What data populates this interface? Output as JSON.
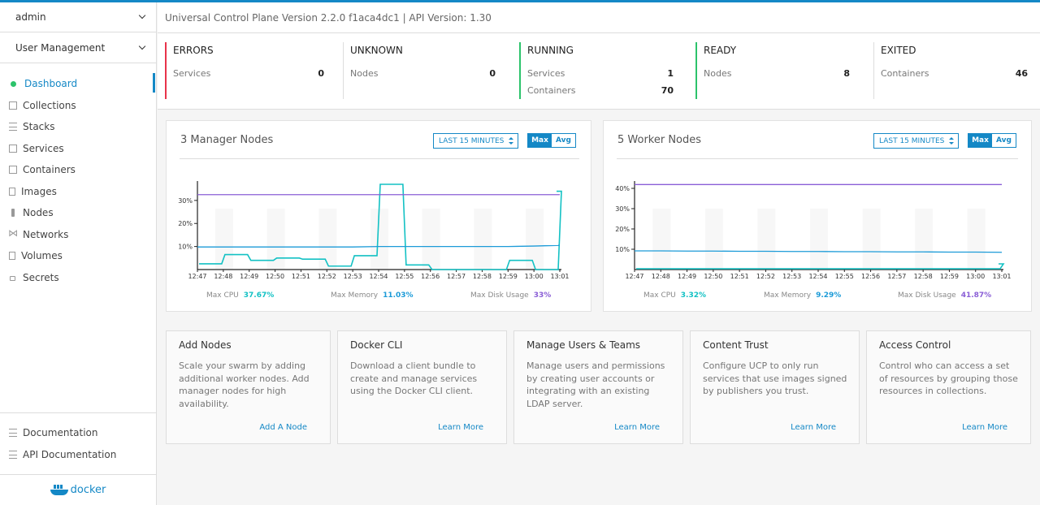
{
  "sidebar": {
    "user": "admin",
    "section": "User Management",
    "nav": [
      {
        "label": "Dashboard",
        "icon": "dashboard-dot-icon",
        "active": true
      },
      {
        "label": "Collections",
        "icon": "collections-icon"
      },
      {
        "label": "Stacks",
        "icon": "stacks-icon"
      },
      {
        "label": "Services",
        "icon": "services-icon"
      },
      {
        "label": "Containers",
        "icon": "containers-icon"
      },
      {
        "label": "Images",
        "icon": "images-icon"
      },
      {
        "label": "Nodes",
        "icon": "nodes-icon"
      },
      {
        "label": "Networks",
        "icon": "networks-icon"
      },
      {
        "label": "Volumes",
        "icon": "volumes-icon"
      },
      {
        "label": "Secrets",
        "icon": "secrets-icon"
      }
    ],
    "footer": [
      {
        "label": "Documentation",
        "icon": "documentation-icon"
      },
      {
        "label": "API Documentation",
        "icon": "api-documentation-icon"
      }
    ],
    "logo": "docker"
  },
  "header": {
    "version": "Universal Control Plane Version 2.2.0 f1aca4dc1 | API Version: 1.30"
  },
  "status": [
    {
      "title": "ERRORS",
      "color": "#e8334a",
      "rows": [
        {
          "label": "Services",
          "value": "0"
        }
      ]
    },
    {
      "title": "UNKNOWN",
      "rows": [
        {
          "label": "Nodes",
          "value": "0"
        }
      ]
    },
    {
      "title": "RUNNING",
      "color": "#2cc36b",
      "rows": [
        {
          "label": "Services",
          "value": "1"
        },
        {
          "label": "Containers",
          "value": "70"
        }
      ]
    },
    {
      "title": "READY",
      "color": "#2cc36b",
      "rows": [
        {
          "label": "Nodes",
          "value": "8"
        }
      ]
    },
    {
      "title": "EXITED",
      "rows": [
        {
          "label": "Containers",
          "value": "46"
        }
      ]
    }
  ],
  "charts": {
    "time_range": "LAST 15 MINUTES",
    "toggle_max": "Max",
    "toggle_avg": "Avg",
    "labels": {
      "cpu": "Max CPU",
      "memory": "Max Memory",
      "disk": "Max Disk Usage"
    },
    "colors": {
      "cpu": "#13c1c4",
      "memory": "#1c9bd8",
      "disk": "#8a5ed6"
    }
  },
  "chart_data": [
    {
      "type": "line",
      "title": "3 Manager Nodes",
      "x": [
        "12:47",
        "12:48",
        "12:49",
        "12:50",
        "12:51",
        "12:52",
        "12:53",
        "12:54",
        "12:55",
        "12:56",
        "12:57",
        "12:58",
        "12:59",
        "13:00",
        "13:01"
      ],
      "yticks": [
        "10%",
        "20%",
        "30%"
      ],
      "ylim": [
        0,
        37
      ],
      "series": [
        {
          "name": "Max CPU",
          "values": [
            2.5,
            6.5,
            4,
            5,
            4.5,
            1.5,
            6,
            37,
            2,
            0,
            0,
            0,
            4,
            0,
            34
          ]
        },
        {
          "name": "Max Memory",
          "values": [
            9.8,
            9.8,
            9.8,
            9.8,
            9.8,
            9.8,
            9.8,
            10,
            10,
            10,
            10,
            10,
            10,
            10.2,
            10.5
          ]
        },
        {
          "name": "Max Disk Usage",
          "values": [
            32.5,
            32.5,
            32.5,
            32.5,
            32.5,
            32.5,
            32.5,
            32.5,
            32.5,
            32.5,
            32.5,
            32.5,
            32.5,
            32.5,
            32.5
          ]
        }
      ],
      "summary": {
        "cpu": "37.67%",
        "memory": "11.03%",
        "disk": "33%"
      }
    },
    {
      "type": "line",
      "title": "5 Worker Nodes",
      "x": [
        "12:47",
        "12:48",
        "12:49",
        "12:50",
        "12:51",
        "12:52",
        "12:53",
        "12:54",
        "12:55",
        "12:56",
        "12:57",
        "12:58",
        "12:59",
        "13:00",
        "13:01"
      ],
      "yticks": [
        "10%",
        "20%",
        "30%",
        "40%"
      ],
      "ylim": [
        0,
        42
      ],
      "series": [
        {
          "name": "Max CPU",
          "values": [
            0.4,
            0.4,
            0.4,
            0.4,
            0.4,
            0.4,
            0.4,
            0.4,
            0.4,
            0.4,
            0.4,
            0.4,
            0.4,
            0.4,
            2.8
          ]
        },
        {
          "name": "Max Memory",
          "values": [
            9.2,
            9.2,
            9.1,
            9.1,
            9.0,
            9.0,
            8.9,
            8.9,
            8.8,
            8.8,
            8.7,
            8.7,
            8.6,
            8.6,
            8.5
          ]
        },
        {
          "name": "Max Disk Usage",
          "values": [
            41.87,
            41.87,
            41.87,
            41.87,
            41.87,
            41.87,
            41.87,
            41.87,
            41.87,
            41.87,
            41.87,
            41.87,
            41.87,
            41.87,
            41.87
          ]
        }
      ],
      "summary": {
        "cpu": "3.32%",
        "memory": "9.29%",
        "disk": "41.87%"
      }
    }
  ],
  "cards": [
    {
      "title": "Add Nodes",
      "body": "Scale your swarm by adding additional worker nodes. Add manager nodes for high availability.",
      "link": "Add A Node"
    },
    {
      "title": "Docker CLI",
      "body": "Download a client bundle to create and manage services using the Docker CLI client.",
      "link": "Learn More"
    },
    {
      "title": "Manage Users & Teams",
      "body": "Manage users and permissions by creating user accounts or integrating with an existing LDAP server.",
      "link": "Learn More"
    },
    {
      "title": "Content Trust",
      "body": "Configure UCP to only run services that use images signed by publishers you trust.",
      "link": "Learn More"
    },
    {
      "title": "Access Control",
      "body": "Control who can access a set of resources by grouping those resources in collections.",
      "link": "Learn More"
    }
  ]
}
